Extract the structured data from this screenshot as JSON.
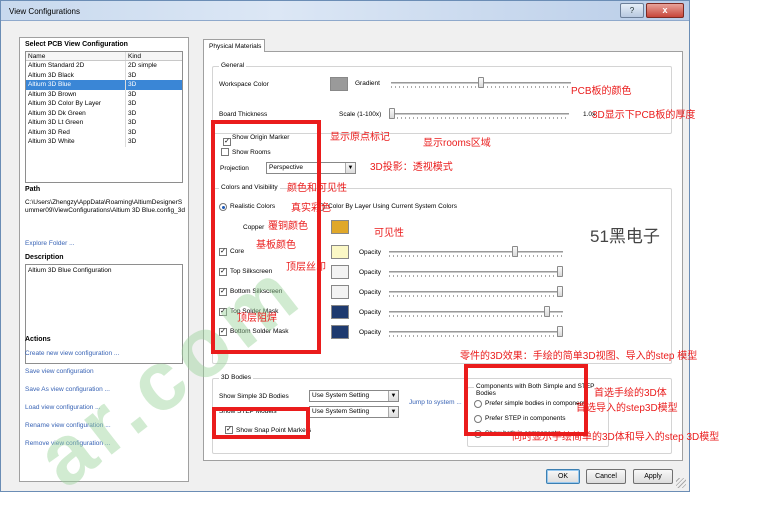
{
  "window": {
    "title": "View Configurations",
    "help_label": "?",
    "close_label": "x"
  },
  "left_panel": {
    "select_title": "Select PCB View Configuration",
    "columns": [
      "Name",
      "Kind"
    ],
    "rows": [
      {
        "name": "Altium Standard 2D",
        "kind": "2D simple"
      },
      {
        "name": "Altium 3D Black",
        "kind": "3D"
      },
      {
        "name": "Altium 3D Blue",
        "kind": "3D",
        "selected": true
      },
      {
        "name": "Altium 3D Brown",
        "kind": "3D"
      },
      {
        "name": "Altium 3D Color By Layer",
        "kind": "3D"
      },
      {
        "name": "Altium 3D Dk Green",
        "kind": "3D"
      },
      {
        "name": "Altium 3D Lt Green",
        "kind": "3D"
      },
      {
        "name": "Altium 3D Red",
        "kind": "3D"
      },
      {
        "name": "Altium 3D White",
        "kind": "3D"
      }
    ],
    "path_title": "Path",
    "path_value": "C:\\Users\\Zhengzy\\AppData\\Roaming\\AltiumDesignerSummer09\\ViewConfigurations\\Altium 3D Blue.config_3d",
    "explore_label": "Explore Folder ...",
    "description_title": "Description",
    "description_value": "Altium 3D Blue Configuration",
    "actions_title": "Actions",
    "actions": [
      "Create new view configuration ...",
      "Save view configuration",
      "Save As view configuration ...",
      "Load view configuration ...",
      "Rename view configuration ...",
      "Remove view configuration ..."
    ]
  },
  "tab_label": "Physical Materials",
  "general": {
    "title": "General",
    "workspace_color_label": "Workspace Color",
    "workspace_color": "#9a9a9a",
    "gradient_label": "Gradient",
    "gradient_level": 0.5,
    "board_thickness_label": "Board Thickness",
    "scale_label": "Scale (1-100x)",
    "scale_value": "1.0x",
    "scale_level": 0.0,
    "show_origin_label": "Show Origin Marker",
    "show_rooms_label": "Show Rooms",
    "projection_label": "Projection",
    "projection_value": "Perspective"
  },
  "colors": {
    "title": "Colors and Visibility",
    "realistic_label": "Realistic Colors",
    "by_layer_label": "Color By Layer Using Current System Colors",
    "copper_label": "Copper",
    "opacity_label": "Opacity",
    "layers": [
      {
        "label": "Core",
        "color": "#fbf8c6",
        "opacity": 0.73
      },
      {
        "label": "Top Silkscreen",
        "color": "#f3f3f3",
        "opacity": 1.0
      },
      {
        "label": "Bottom Silkscreen",
        "color": "#f3f3f3",
        "opacity": 1.0
      },
      {
        "label": "Top Solder Mask",
        "color": "#1e3a6e",
        "opacity": 0.92
      },
      {
        "label": "Bottom Solder Mask",
        "color": "#1e3a6e",
        "opacity": 1.0
      }
    ],
    "copper_color": "#e0a82a"
  },
  "bodies": {
    "title": "3D Bodies",
    "simple_label": "Show Simple 3D Bodies",
    "simple_value": "Use System Setting",
    "step_label": "Show STEP Models",
    "step_value": "Use System Setting",
    "jump_label": "Jump to system ...",
    "snap_label": "Show Snap Point Markers"
  },
  "components": {
    "title": "Components with Both Simple and STEP Bodies",
    "options": [
      "Prefer simple bodies in components",
      "Prefer STEP in components",
      "Show both in components"
    ]
  },
  "buttons": {
    "ok": "OK",
    "cancel": "Cancel",
    "apply": "Apply"
  },
  "annotations": {
    "pcb_color": "PCB板的颜色",
    "thickness": "3D显示下PCB板的厚度",
    "origin": "显示原点标记",
    "rooms": "显示rooms区域",
    "projection": "3D投影：透视模式",
    "color_vis": "颜色和可见性",
    "realistic": "真实彩色",
    "copper": "覆铜颜色",
    "core": "基板颜色",
    "visible": "可见性",
    "top_silk": "顶层丝印",
    "top_mask": "顶层阻焊",
    "component_3d": "零件的3D效果：手绘的简单3D视图、导入的step 模型",
    "prefer_simple": "首选手绘的3D体",
    "prefer_step": "首选导入的step3D模型",
    "show_both": "同时显示手绘简单的3D体和导入的step 3D模型",
    "logo": "51黑电子"
  },
  "watermark": "ar.com"
}
